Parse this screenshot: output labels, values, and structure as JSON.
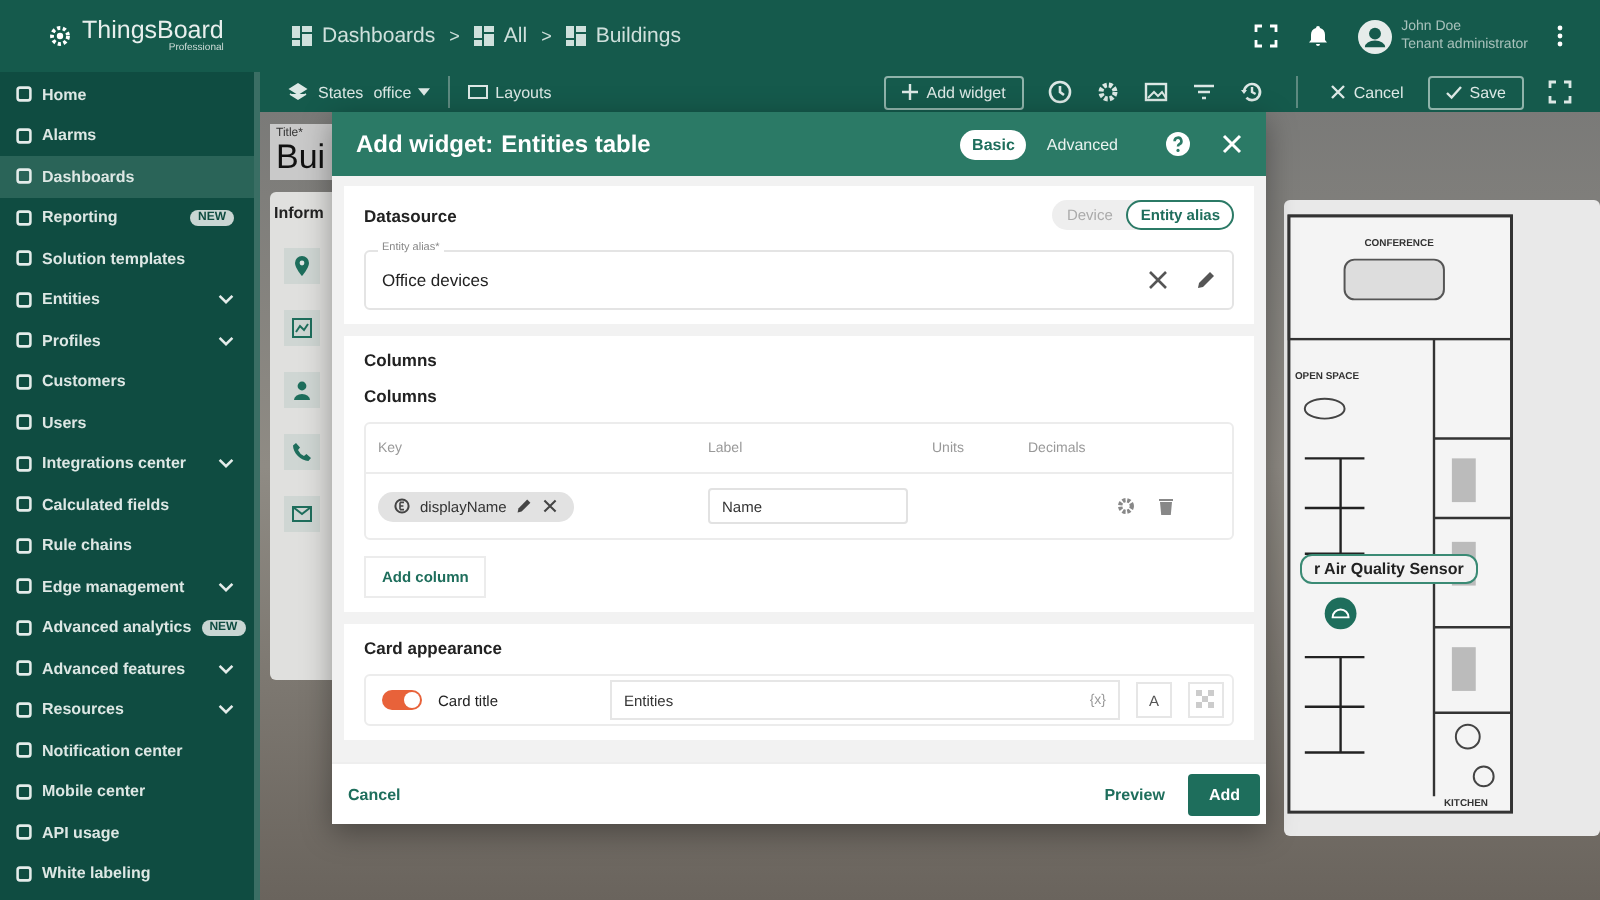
{
  "app": {
    "logo": "ThingsBoard",
    "edition": "Professional"
  },
  "breadcrumb": [
    {
      "label": "Dashboards"
    },
    {
      "separator": ">",
      "label": "All"
    },
    {
      "separator": ">",
      "label": "Buildings"
    }
  ],
  "user": {
    "name": "John Doe",
    "role": "Tenant administrator"
  },
  "sidebar": {
    "items": [
      {
        "label": "Home",
        "kind": "link",
        "selected": false
      },
      {
        "label": "Alarms",
        "kind": "link",
        "selected": false
      },
      {
        "label": "Dashboards",
        "kind": "link",
        "selected": true
      },
      {
        "label": "Reporting",
        "kind": "link",
        "selected": false,
        "badge": "NEW"
      },
      {
        "label": "Solution templates",
        "kind": "link",
        "selected": false
      },
      {
        "label": "Entities",
        "kind": "group",
        "selected": false
      },
      {
        "label": "Profiles",
        "kind": "group",
        "selected": false
      },
      {
        "label": "Customers",
        "kind": "link",
        "selected": false
      },
      {
        "label": "Users",
        "kind": "link",
        "selected": false
      },
      {
        "label": "Integrations center",
        "kind": "group",
        "selected": false
      },
      {
        "label": "Calculated fields",
        "kind": "link",
        "selected": false
      },
      {
        "label": "Rule chains",
        "kind": "link",
        "selected": false
      },
      {
        "label": "Edge management",
        "kind": "group",
        "selected": false
      },
      {
        "label": "Advanced analytics",
        "kind": "link",
        "selected": false,
        "badge": "NEW"
      },
      {
        "label": "Advanced features",
        "kind": "group",
        "selected": false
      },
      {
        "label": "Resources",
        "kind": "group",
        "selected": false
      },
      {
        "label": "Notification center",
        "kind": "link",
        "selected": false
      },
      {
        "label": "Mobile center",
        "kind": "link",
        "selected": false
      },
      {
        "label": "API usage",
        "kind": "link",
        "selected": false
      },
      {
        "label": "White labeling",
        "kind": "link",
        "selected": false
      }
    ]
  },
  "toolbar": {
    "states_label": "States",
    "state_value": "office",
    "layouts_label": "Layouts",
    "add_widget": "Add widget",
    "cancel": "Cancel",
    "save": "Save"
  },
  "background": {
    "title_label": "Title*",
    "title_value": "Bui",
    "card_title": "Inform"
  },
  "floor_plan": {
    "rooms": [
      "CONFERENCE",
      "OPEN SPACE",
      "KITCHEN"
    ],
    "tooltip": "r Air Quality Sensor"
  },
  "dialog": {
    "title": "Add widget:",
    "widget_name": "Entities table",
    "modes": [
      {
        "label": "Basic",
        "selected": true
      },
      {
        "label": "Advanced",
        "selected": false
      }
    ],
    "datasource": {
      "title": "Datasource",
      "types": [
        {
          "label": "Device",
          "selected": false
        },
        {
          "label": "Entity alias",
          "selected": true
        }
      ],
      "alias_label": "Entity alias*",
      "alias_value": "Office devices"
    },
    "columns": {
      "title": "Columns",
      "subtitle": "Columns",
      "headers": [
        "Key",
        "Label",
        "Units",
        "Decimals"
      ],
      "rows": [
        {
          "key": "displayName",
          "label": "Name"
        }
      ],
      "add_button": "Add column"
    },
    "card_appearance": {
      "title": "Card appearance",
      "card_title": {
        "on": true,
        "label": "Card title",
        "value": "Entities",
        "variable_hint": "{x}",
        "font_button": "A"
      }
    },
    "footer": {
      "cancel": "Cancel",
      "preview": "Preview",
      "add": "Add"
    }
  }
}
